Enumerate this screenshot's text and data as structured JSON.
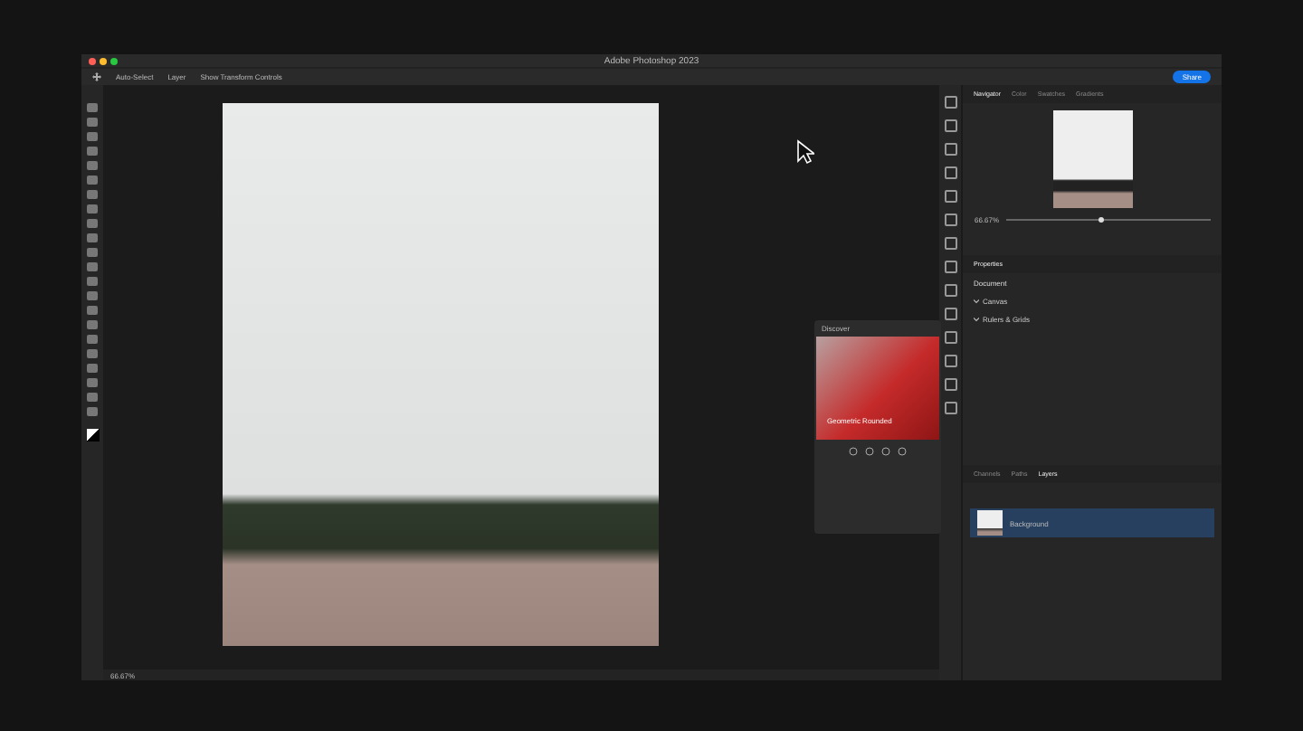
{
  "window": {
    "title": "Adobe Photoshop 2023"
  },
  "options_bar": {
    "labels": [
      "Auto-Select",
      "Layer",
      "Show Transform Controls"
    ]
  },
  "share_button": "Share",
  "navigator": {
    "tabs": [
      {
        "label": "Navigator",
        "selected": true
      },
      {
        "label": "Color",
        "selected": false
      },
      {
        "label": "Swatches",
        "selected": false
      },
      {
        "label": "Gradients",
        "selected": false
      }
    ],
    "zoom": "66.67%",
    "level": 0.45
  },
  "properties": {
    "title": "Properties",
    "subtitle": "Document",
    "sections": [
      {
        "title": "Canvas",
        "expanded": true
      },
      {
        "title": "Rulers & Grids",
        "expanded": true
      }
    ]
  },
  "layers": {
    "tabs": [
      {
        "label": "Channels",
        "selected": false
      },
      {
        "label": "Paths",
        "selected": false
      },
      {
        "label": "Layers",
        "selected": true
      }
    ],
    "items": [
      {
        "name": "Background",
        "selected": true
      }
    ]
  },
  "discover": {
    "title": "Discover",
    "card_title": "Geometric Rounded"
  },
  "status_bar": {
    "zoom": "66.67%"
  }
}
